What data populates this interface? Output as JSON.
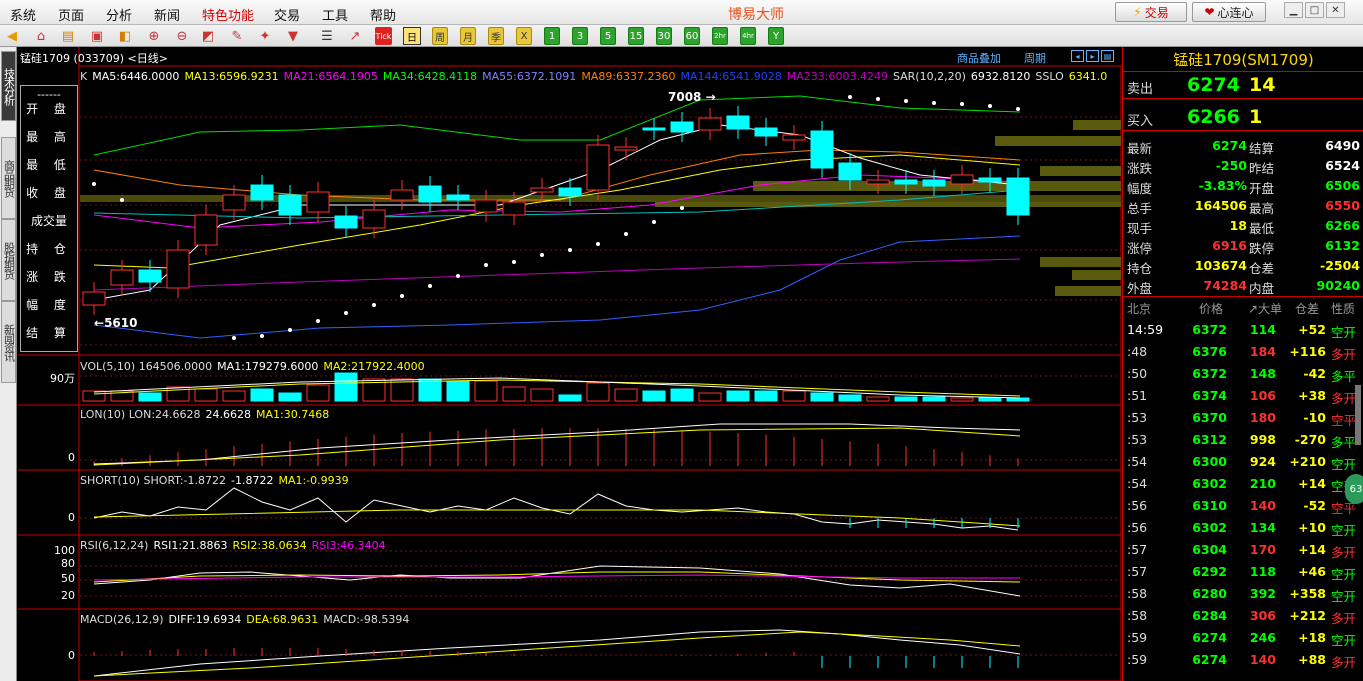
{
  "menu": {
    "items": [
      "系统",
      "页面",
      "分析",
      "新闻",
      "特色功能",
      "交易",
      "工具",
      "帮助"
    ],
    "highlight_index": 4,
    "app_title": "博易大师",
    "trade_label": "交易",
    "connect_label": "心连心"
  },
  "toolbar": {
    "period_buttons": [
      "日",
      "周",
      "月",
      "季",
      "X",
      "1",
      "3",
      "5",
      "15",
      "30",
      "60",
      "2hr",
      "4hr",
      "Y"
    ],
    "tick_label": "Tick"
  },
  "left_tabs": [
    "技术分析",
    "商品期货",
    "股指期货",
    "新闻资讯"
  ],
  "chart": {
    "title": "锰硅1709 (033709) <日线>",
    "overlay_link": "商品叠加",
    "period_link": "周期",
    "ma_line": [
      {
        "t": "K",
        "c": "#dddddd"
      },
      {
        "t": "MA5:6446.0000",
        "c": "#ffffff"
      },
      {
        "t": "MA13:6596.9231",
        "c": "#ffff00"
      },
      {
        "t": "MA21:6564.1905",
        "c": "#ff00ff"
      },
      {
        "t": "MA34:6428.4118",
        "c": "#00ff00"
      },
      {
        "t": "MA55:6372.1091",
        "c": "#8080ff"
      },
      {
        "t": "MA89:6337.2360",
        "c": "#ff8000"
      },
      {
        "t": "MA144:6541.9028",
        "c": "#2040ff"
      },
      {
        "t": "MA233:6003.4249",
        "c": "#c000c0"
      },
      {
        "t": "SAR(10,2,20)",
        "c": "#dddddd"
      },
      {
        "t": "6932.8120",
        "c": "#ffffff"
      },
      {
        "t": "SSLO",
        "c": "#dddddd"
      },
      {
        "t": "6341.0",
        "c": "#ffff00"
      }
    ],
    "high_marker": "7008",
    "low_marker": "5610",
    "quote_labels": [
      "开 盘",
      "最 高",
      "最 低",
      "收 盘",
      "成交量",
      "持 仓",
      "涨 跌",
      "幅 度",
      "结 算"
    ],
    "quote_dash": "------",
    "vol": {
      "label": [
        {
          "t": "VOL(5,10) 164506.0000",
          "c": "#dddddd"
        },
        {
          "t": "MA1:179279.6000",
          "c": "#ffffff"
        },
        {
          "t": "MA2:217922.4000",
          "c": "#ffff00"
        }
      ],
      "ytick": "90万"
    },
    "lon": {
      "label": [
        {
          "t": "LON(10) LON:24.6628",
          "c": "#dddddd"
        },
        {
          "t": "24.6628",
          "c": "#ffffff"
        },
        {
          "t": "MA1:30.7468",
          "c": "#ffff00"
        }
      ],
      "ytick": "0"
    },
    "short": {
      "label": [
        {
          "t": "SHORT(10) SHORT:-1.8722",
          "c": "#dddddd"
        },
        {
          "t": "-1.8722",
          "c": "#ffffff"
        },
        {
          "t": "MA1:-0.9939",
          "c": "#ffff00"
        }
      ],
      "ytick": "0"
    },
    "rsi": {
      "label": [
        {
          "t": "RSI(6,12,24)",
          "c": "#dddddd"
        },
        {
          "t": "RSI1:21.8863",
          "c": "#ffffff"
        },
        {
          "t": "RSI2:38.0634",
          "c": "#ffff00"
        },
        {
          "t": "RSI3:46.3404",
          "c": "#ff00ff"
        }
      ],
      "yticks": [
        "100",
        "80",
        "50",
        "20"
      ]
    },
    "macd": {
      "label": [
        {
          "t": "MACD(26,12,9)",
          "c": "#dddddd"
        },
        {
          "t": "DIFF:19.6934",
          "c": "#ffffff"
        },
        {
          "t": "DEA:68.9631",
          "c": "#ffff00"
        },
        {
          "t": "MACD:-98.5394",
          "c": "#dddddd"
        }
      ],
      "ytick": "0"
    }
  },
  "panel": {
    "header": "锰硅1709(SM1709)",
    "sell": {
      "label": "卖出",
      "price": "6274",
      "qty": "14"
    },
    "buy": {
      "label": "买入",
      "price": "6266",
      "qty": "1"
    },
    "stats": [
      [
        {
          "l": "最新",
          "v": "6274",
          "c": "#00ff00"
        },
        {
          "l": "结算",
          "v": "6490",
          "c": "#ffffff"
        }
      ],
      [
        {
          "l": "涨跌",
          "v": "-250",
          "c": "#00ff00"
        },
        {
          "l": "昨结",
          "v": "6524",
          "c": "#ffffff"
        }
      ],
      [
        {
          "l": "幅度",
          "v": "-3.83%",
          "c": "#00ff00"
        },
        {
          "l": "开盘",
          "v": "6506",
          "c": "#00ff00"
        }
      ],
      [
        {
          "l": "总手",
          "v": "164506",
          "c": "#ffff00"
        },
        {
          "l": "最高",
          "v": "6550",
          "c": "#ff3030"
        }
      ],
      [
        {
          "l": "现手",
          "v": "18",
          "c": "#ffff00"
        },
        {
          "l": "最低",
          "v": "6266",
          "c": "#00ff00"
        }
      ],
      [
        {
          "l": "涨停",
          "v": "6916",
          "c": "#ff3030"
        },
        {
          "l": "跌停",
          "v": "6132",
          "c": "#00ff00"
        }
      ],
      [
        {
          "l": "持仓",
          "v": "103674",
          "c": "#ffff00"
        },
        {
          "l": "仓差",
          "v": "-2504",
          "c": "#ffff00"
        }
      ],
      [
        {
          "l": "外盘",
          "v": "74284",
          "c": "#ff3030"
        },
        {
          "l": "内盘",
          "v": "90240",
          "c": "#00ff00"
        }
      ]
    ],
    "tick_headers": [
      "北京",
      "价格",
      "↗大单",
      "仓差",
      "性质"
    ],
    "ticks": [
      {
        "t": "14:59",
        "p": "6372",
        "v": "114",
        "vc": "#00ff00",
        "d": "+52",
        "n": "空开",
        "nc": "#00ff00"
      },
      {
        "t": ":48",
        "p": "6376",
        "v": "184",
        "vc": "#ff3030",
        "d": "+116",
        "n": "多开",
        "nc": "#ff3030"
      },
      {
        "t": ":50",
        "p": "6372",
        "v": "148",
        "vc": "#00ff00",
        "d": "-42",
        "n": "多平",
        "nc": "#00ff00"
      },
      {
        "t": ":51",
        "p": "6374",
        "v": "106",
        "vc": "#ff3030",
        "d": "+38",
        "n": "多开",
        "nc": "#ff3030"
      },
      {
        "t": ":53",
        "p": "6370",
        "v": "180",
        "vc": "#ff3030",
        "d": "-10",
        "n": "空平",
        "nc": "#ff3030"
      },
      {
        "t": ":53",
        "p": "6312",
        "v": "998",
        "vc": "#ffff00",
        "d": "-270",
        "n": "多平",
        "nc": "#00ff00"
      },
      {
        "t": ":54",
        "p": "6300",
        "v": "924",
        "vc": "#ffff00",
        "d": "+210",
        "n": "空开",
        "nc": "#00ff00"
      },
      {
        "t": ":54",
        "p": "6302",
        "v": "210",
        "vc": "#00ff00",
        "d": "+14",
        "n": "空开",
        "nc": "#00ff00"
      },
      {
        "t": ":56",
        "p": "6310",
        "v": "140",
        "vc": "#ff3030",
        "d": "-52",
        "n": "空平",
        "nc": "#ff3030"
      },
      {
        "t": ":56",
        "p": "6302",
        "v": "134",
        "vc": "#00ff00",
        "d": "+10",
        "n": "空开",
        "nc": "#00ff00"
      },
      {
        "t": ":57",
        "p": "6304",
        "v": "170",
        "vc": "#ff3030",
        "d": "+14",
        "n": "多开",
        "nc": "#ff3030"
      },
      {
        "t": ":57",
        "p": "6292",
        "v": "118",
        "vc": "#00ff00",
        "d": "+46",
        "n": "空开",
        "nc": "#00ff00"
      },
      {
        "t": ":58",
        "p": "6280",
        "v": "392",
        "vc": "#00ff00",
        "d": "+358",
        "n": "空开",
        "nc": "#00ff00"
      },
      {
        "t": ":58",
        "p": "6284",
        "v": "306",
        "vc": "#ff3030",
        "d": "+212",
        "n": "多开",
        "nc": "#ff3030"
      },
      {
        "t": ":59",
        "p": "6274",
        "v": "246",
        "vc": "#00ff00",
        "d": "+18",
        "n": "空开",
        "nc": "#00ff00"
      },
      {
        "t": ":59",
        "p": "6274",
        "v": "140",
        "vc": "#ff3030",
        "d": "+88",
        "n": "多开",
        "nc": "#ff3030"
      }
    ],
    "float_label": "63"
  }
}
